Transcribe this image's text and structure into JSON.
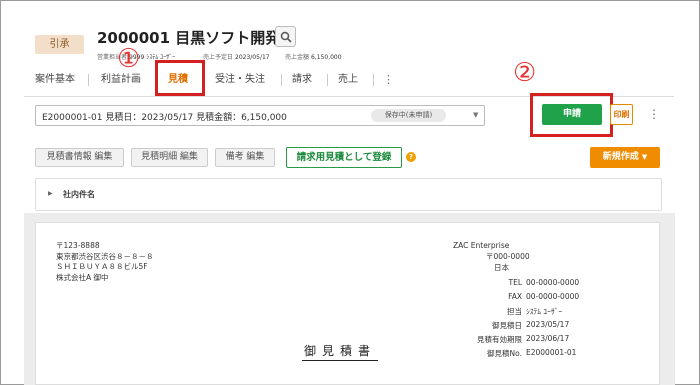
{
  "header": {
    "status_badge": "引承",
    "title": "2000001 目黒ソフト開発",
    "meta": {
      "sales_rep_label": "営業担当者",
      "sales_rep_value": "9999 ｼｽﾃﾑ ﾕｰｻﾞｰ",
      "planned_date_label": "売上予定日",
      "planned_date_value": "2023/05/17",
      "amount_label": "売上金額",
      "amount_value": "6,150,000"
    }
  },
  "tabs": [
    {
      "label": "案件基本"
    },
    {
      "label": "利益計画"
    },
    {
      "label": "見積"
    },
    {
      "label": "受注・失注"
    },
    {
      "label": "請求"
    },
    {
      "label": "売上"
    }
  ],
  "annotations": {
    "step1": "①",
    "step2": "②"
  },
  "estimate_select": {
    "value": "E2000001-01 見積日：2023/05/17 見積金額：6,150,000",
    "status_chip": "保存中(未申請)"
  },
  "actions": {
    "apply_label": "申請",
    "print_label": "印刷"
  },
  "toolbar": {
    "edit_info": "見積書情報 編集",
    "edit_detail": "見積明細 編集",
    "edit_note": "備考 編集",
    "register_billing": "請求用見積として登録",
    "new_create": "新規作成"
  },
  "accordion": {
    "label": "社内件名"
  },
  "document": {
    "postal": "〒123-8888",
    "address1": "東京都渋谷区渋谷８－８－８",
    "address2": "ＳＨＩＢＵＹＡ８８ビル5F",
    "recipient": "株式会社A 御中",
    "title": "御見積書",
    "company": "ZAC Enterprise",
    "company_postal": "〒000-0000",
    "company_country": "日本",
    "tel_label": "TEL",
    "tel_value": "00-0000-0000",
    "fax_label": "FAX",
    "fax_value": "00-0000-0000",
    "person_label": "担当",
    "person_value": "ｼｽﾃﾑ ﾕｰｻﾞｰ",
    "estimate_date_label": "御見積日",
    "estimate_date_value": "2023/05/17",
    "valid_until_label": "見積有効期限",
    "valid_until_value": "2023/06/17",
    "estimate_no_label": "御見積No.",
    "estimate_no_value": "E2000001-01"
  },
  "colors": {
    "accent_orange": "#e07000",
    "apply_green": "#1fa24a",
    "annotation_red": "#d42020"
  }
}
